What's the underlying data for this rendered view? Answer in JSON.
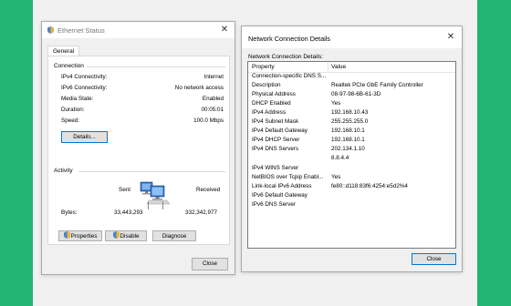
{
  "colors": {
    "background": "#21b574",
    "focus_border": "#0078d7"
  },
  "ethernet_status": {
    "title": "Ethernet Status",
    "title_icon": "network-adapter-icon",
    "tab_general": "General",
    "connection": {
      "heading": "Connection",
      "rows": [
        {
          "label": "IPv4 Connectivity:",
          "value": "Internet"
        },
        {
          "label": "IPv6 Connectivity:",
          "value": "No network access"
        },
        {
          "label": "Media State:",
          "value": "Enabled"
        },
        {
          "label": "Duration:",
          "value": "00:05:01"
        },
        {
          "label": "Speed:",
          "value": "100.0 Mbps"
        }
      ],
      "details_button": "Details..."
    },
    "activity": {
      "heading": "Activity",
      "sent_label": "Sent",
      "received_label": "Received",
      "bytes_label": "Bytes:",
      "bytes_sent": "33,443,293",
      "bytes_received": "332,342,977",
      "icon": "network-computers-icon"
    },
    "buttons": {
      "properties": "Properties",
      "disable": "Disable",
      "diagnose": "Diagnose",
      "close": "Close"
    }
  },
  "connection_details": {
    "title": "Network Connection Details",
    "label": "Network Connection Details:",
    "columns": {
      "property": "Property",
      "value": "Value"
    },
    "rows": [
      {
        "property": "Connection-specific DNS S...",
        "value": ""
      },
      {
        "property": "Description",
        "value": "Realtek PCIe GbE Family Controller"
      },
      {
        "property": "Physical Address",
        "value": "08-97-98-6B-61-3D"
      },
      {
        "property": "DHCP Enabled",
        "value": "Yes"
      },
      {
        "property": "IPv4 Address",
        "value": "192.168.10.43"
      },
      {
        "property": "IPv4 Subnet Mask",
        "value": "255.255.255.0"
      },
      {
        "property": "IPv4 Default Gateway",
        "value": "192.168.10.1"
      },
      {
        "property": "IPv4 DHCP Server",
        "value": "192.168.10.1"
      },
      {
        "property": "IPv4 DNS Servers",
        "value": "202.134.1.10"
      },
      {
        "property": "",
        "value": "8.8.4.4"
      },
      {
        "property": "IPv4 WINS Server",
        "value": ""
      },
      {
        "property": "NetBIOS over Tcpip Enabl...",
        "value": "Yes"
      },
      {
        "property": "Link-local IPv6 Address",
        "value": "fe80::d118:83f6:4254:e5d2%4"
      },
      {
        "property": "IPv6 Default Gateway",
        "value": ""
      },
      {
        "property": "IPv6 DNS Server",
        "value": ""
      }
    ],
    "close_button": "Close"
  }
}
